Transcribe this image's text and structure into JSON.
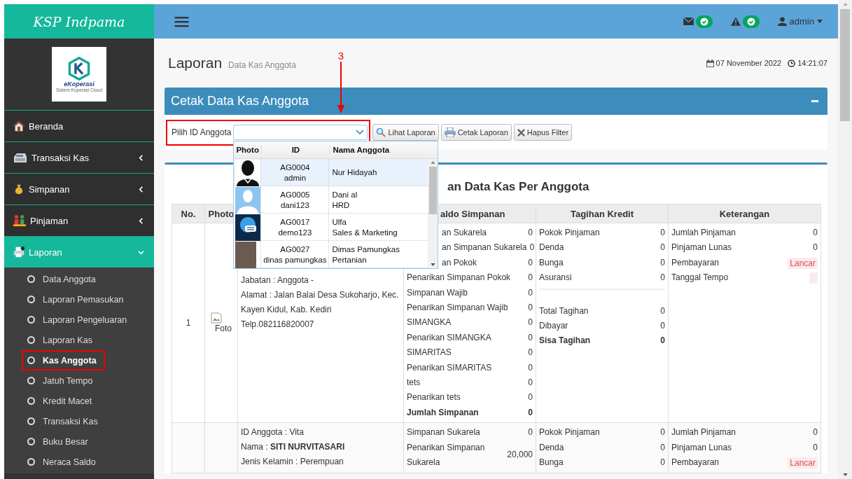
{
  "brand": "KSP Indpama",
  "logo": {
    "name": "eKoperasi",
    "tagline": "Sistem Koperasi Cloud"
  },
  "sidebar": {
    "items": [
      {
        "label": "Beranda",
        "kind": "link"
      },
      {
        "label": "Transaksi Kas",
        "kind": "group",
        "expanded": false
      },
      {
        "label": "Simpanan",
        "kind": "group",
        "expanded": false
      },
      {
        "label": "Pinjaman",
        "kind": "group",
        "expanded": false
      },
      {
        "label": "Laporan",
        "kind": "group",
        "expanded": true,
        "children": [
          {
            "label": "Data Anggota",
            "selected": false
          },
          {
            "label": "Laporan Pemasukan",
            "selected": false
          },
          {
            "label": "Laporan Pengeluaran",
            "selected": false
          },
          {
            "label": "Laporan Kas",
            "selected": false
          },
          {
            "label": "Kas Anggota",
            "selected": true
          },
          {
            "label": "Jatuh Tempo",
            "selected": false
          },
          {
            "label": "Kredit Macet",
            "selected": false
          },
          {
            "label": "Transaksi Kas",
            "selected": false
          },
          {
            "label": "Buku Besar",
            "selected": false
          },
          {
            "label": "Neraca Saldo",
            "selected": false
          }
        ]
      }
    ]
  },
  "topbar": {
    "user": "admin"
  },
  "header": {
    "title": "Laporan",
    "subtitle": "Data Kas Anggota",
    "date": "07 November 2022",
    "time": "14:21:07"
  },
  "panel": {
    "title": "Cetak Data Kas Anggota"
  },
  "filter": {
    "label": "Pilih ID Anggota",
    "buttons": [
      "Lihat Laporan",
      "Cetak Laporan",
      "Hapus Filter"
    ]
  },
  "annotation": {
    "label": "3"
  },
  "dropdown": {
    "columns": [
      "Photo",
      "ID",
      "Nama Anggota"
    ],
    "rows": [
      {
        "kind": "silhouette",
        "id": "AG0004",
        "username": "admin",
        "name": "Nur Hidayah",
        "selected": true
      },
      {
        "kind": "placeholder",
        "id": "AG0005",
        "username": "dani123",
        "name": "Dani al",
        "note": "HRD",
        "selected": false
      },
      {
        "kind": "logo",
        "id": "AG0017",
        "username": "demo123",
        "name": "Ulfa",
        "note": "Sales & Marketing",
        "selected": false
      },
      {
        "kind": "photo",
        "id": "AG0027",
        "username": "dinas pamungkas",
        "name": "Dimas Pamungkas",
        "note": "Pertanian",
        "selected": false
      }
    ]
  },
  "report": {
    "title": "an Data Kas Per Anggota",
    "headers": {
      "no": "No.",
      "photo": "Photo",
      "saldo": "aldo Simpanan",
      "tagihan": "Tagihan Kredit",
      "keterangan": "Keterangan"
    },
    "rows": [
      {
        "no": "1",
        "photo": "Foto",
        "member": [
          "Jabatan : Anggota -",
          "Alamat : Jalan Balai Desa Sukoharjo, Kec. Kayen Kidul, Kab. Kediri",
          "Telp.082116820007"
        ],
        "saldo": [
          {
            "kind": "line",
            "label": "an Sukarela",
            "value": "0"
          },
          {
            "kind": "line",
            "label": "an Simpanan Sukarela",
            "value": "0"
          },
          {
            "kind": "line",
            "label": "an Pokok",
            "value": "0"
          },
          {
            "kind": "line",
            "label": "Penarikan Simpanan Pokok",
            "value": "0"
          },
          {
            "kind": "line",
            "label": "Simpanan Wajib",
            "value": "0"
          },
          {
            "kind": "line",
            "label": "Penarikan Simpanan Wajib",
            "value": "0"
          },
          {
            "kind": "line",
            "label": "SIMANGKA",
            "value": "0"
          },
          {
            "kind": "line",
            "label": "Penarikan SIMANGKA",
            "value": "0"
          },
          {
            "kind": "line",
            "label": "SIMARITAS",
            "value": "0"
          },
          {
            "kind": "line",
            "label": "Penarikan SIMARITAS",
            "value": "0"
          },
          {
            "kind": "line",
            "label": "tets",
            "value": "0"
          },
          {
            "kind": "line",
            "label": "Penarikan tets",
            "value": "0"
          },
          {
            "kind": "total",
            "label": "Jumlah Simpanan",
            "value": "0"
          }
        ],
        "tagihan": [
          {
            "kind": "line",
            "label": "Pokok Pinjaman",
            "value": "0"
          },
          {
            "kind": "line",
            "label": "Denda",
            "value": "0"
          },
          {
            "kind": "line",
            "label": "Bunga",
            "value": "0"
          },
          {
            "kind": "line",
            "label": "Asuransi",
            "value": "0"
          }
        ],
        "tagihan_totals": [
          {
            "kind": "line",
            "label": "Total Tagihan",
            "value": "0"
          },
          {
            "kind": "line",
            "label": "Dibayar",
            "value": "0"
          },
          {
            "kind": "total",
            "label": "Sisa Tagihan",
            "value": "0"
          }
        ],
        "keterangan": [
          {
            "kind": "line",
            "label": "Jumlah Pinjaman",
            "value": "0"
          },
          {
            "kind": "line",
            "label": "Pinjaman Lunas",
            "value": "0"
          },
          {
            "kind": "badge",
            "label": "Pembayaran",
            "value": "Lancar"
          },
          {
            "kind": "badge",
            "label": "Tanggal Tempo"
          }
        ]
      },
      {
        "member": [
          "ID Anggota : Vita",
          "Nama : **SITI NURVITASARI**",
          "Jenis Kelamin : Perempuan"
        ],
        "saldo": [
          {
            "kind": "line",
            "label": "Simpanan Sukarela",
            "value": "0"
          },
          {
            "kind": "line",
            "label": "Penarikan Simpanan Sukarela",
            "value": "20,000"
          }
        ],
        "tagihan": [
          {
            "kind": "line",
            "label": "Pokok Pinjaman",
            "value": "0"
          },
          {
            "kind": "line",
            "label": "Denda",
            "value": "0"
          },
          {
            "kind": "line",
            "label": "Bunga",
            "value": "0"
          }
        ],
        "keterangan": [
          {
            "kind": "line",
            "label": "Jumlah Pinjaman",
            "value": "0"
          },
          {
            "kind": "line",
            "label": "Pinjaman Lunas",
            "value": "0"
          },
          {
            "kind": "badge",
            "label": "Pembayaran",
            "value": "Lancar"
          }
        ]
      }
    ]
  }
}
